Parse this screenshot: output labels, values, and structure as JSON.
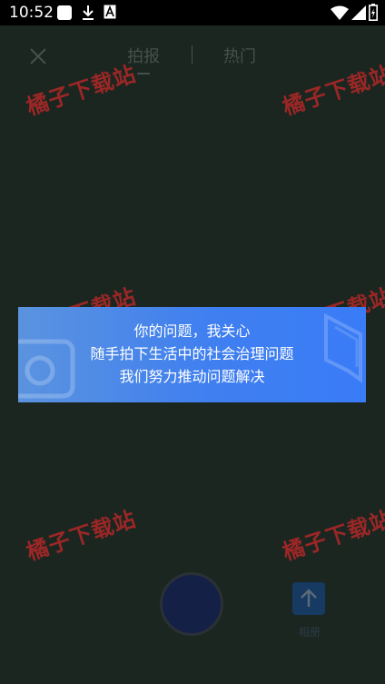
{
  "status_bar": {
    "time": "10:52",
    "left_icons": [
      "square-app-icon",
      "download-icon",
      "font-a-icon"
    ],
    "right_icons": [
      "wifi-icon",
      "signal-icon",
      "battery-icon"
    ]
  },
  "header": {
    "tabs": [
      {
        "label": "拍报",
        "active": true
      },
      {
        "label": "热门",
        "active": false
      }
    ]
  },
  "banner": {
    "lines": [
      "你的问题，我关心",
      "随手拍下生活中的社会治理问题",
      "我们努力推动问题解决"
    ],
    "gradient_start": "#5b93df",
    "gradient_end": "#3a7cf7"
  },
  "watermark": {
    "text": "橘子下载站"
  },
  "bottom": {
    "upload_label": "相册"
  },
  "colors": {
    "background": "#1b2620",
    "watermark": "#be2828"
  }
}
